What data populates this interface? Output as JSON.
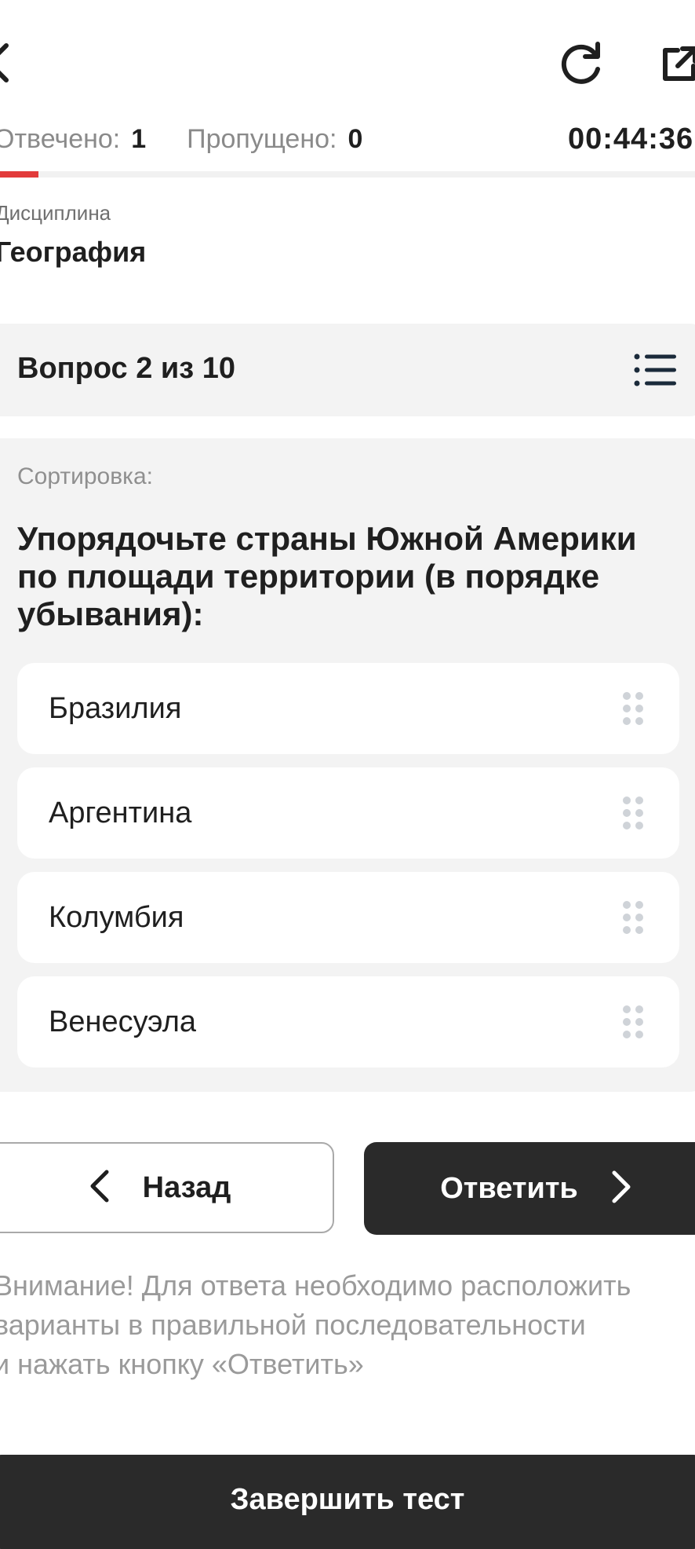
{
  "header": {
    "stats": {
      "answered_label": "Отвечено:",
      "answered_value": "1",
      "skipped_label": "Пропущено:",
      "skipped_value": "0"
    },
    "timer": "00:44:36",
    "progress_fraction": 0.055
  },
  "discipline": {
    "label": "Дисциплина",
    "value": "География"
  },
  "question": {
    "header": "Вопрос 2 из 10",
    "type": "Сортировка:",
    "text": "Упорядочьте страны Южной Америки по площади территории (в порядке убывания):",
    "options": [
      "Бразилия",
      "Аргентина",
      "Колумбия",
      "Венесуэла"
    ]
  },
  "buttons": {
    "back": "Назад",
    "answer": "Ответить",
    "finish": "Завершить тест"
  },
  "notice": "Внимание! Для ответа необходимо расположить\nварианты в правильной последовательности\nи нажать кнопку «Ответить»",
  "colors": {
    "accent": "#e23b3b",
    "dark_button": "#2a2a2a",
    "card_bg": "#f3f3f3"
  },
  "icons": {
    "back": "chevron-left-icon",
    "refresh": "refresh-icon",
    "external": "external-link-icon",
    "list": "list-icon",
    "drag": "drag-handle-icon",
    "next": "chevron-right-icon"
  }
}
